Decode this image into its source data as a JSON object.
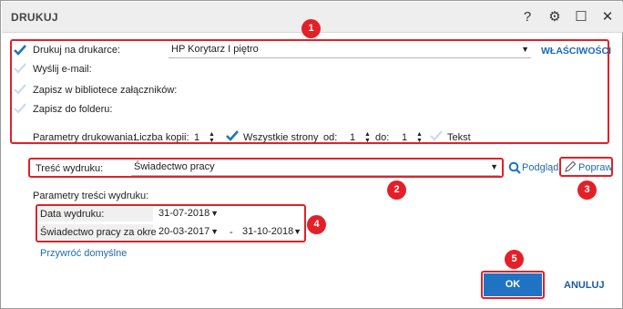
{
  "window": {
    "title": "DRUKUJ"
  },
  "titlebar_icons": [
    "help-icon",
    "gear-icon",
    "maximize-icon",
    "close-icon"
  ],
  "titlebar_glyphs": {
    "help": "?",
    "gear": "⚙",
    "maximize": "☐",
    "close": "✕"
  },
  "print_options": {
    "printer": {
      "label": "Drukuj na drukarce:",
      "value": "HP Korytarz I piętro",
      "checked": true
    },
    "properties_link": "WŁAŚCIWOŚCI",
    "email": {
      "label": "Wyślij e-mail:",
      "checked": false
    },
    "attachments": {
      "label": "Zapisz w bibliotece załączników:",
      "checked": false
    },
    "folder": {
      "label": "Zapisz do folderu:",
      "checked": false
    }
  },
  "print_params": {
    "label": "Parametry drukowania:",
    "copies_label": "Liczba kopii:",
    "copies_value": "1",
    "all_pages_label": "Wszystkie strony",
    "all_pages_checked": true,
    "from_label": "od:",
    "from_value": "1",
    "to_label": "do:",
    "to_value": "1",
    "text_label": "Tekst",
    "text_checked": false
  },
  "content": {
    "label": "Treść wydruku:",
    "value": "Świadectwo pracy",
    "preview_label": "Podgląd",
    "edit_label": "Popraw"
  },
  "content_params": {
    "heading": "Parametry treści wydruku:",
    "print_date_label": "Data wydruku:",
    "print_date_value": "31-07-2018",
    "period_label": "Świadectwo pracy za okres:",
    "period_from": "20-03-2017",
    "period_separator": "-",
    "period_to": "31-10-2018",
    "restore_defaults": "Przywróć domyślne"
  },
  "buttons": {
    "ok": "OK",
    "cancel": "ANULUJ"
  },
  "callouts": [
    "1",
    "2",
    "3",
    "4",
    "5"
  ],
  "colors": {
    "accent": "#1f73c2",
    "callout_red": "#e32028",
    "link": "#1c6bb0"
  }
}
